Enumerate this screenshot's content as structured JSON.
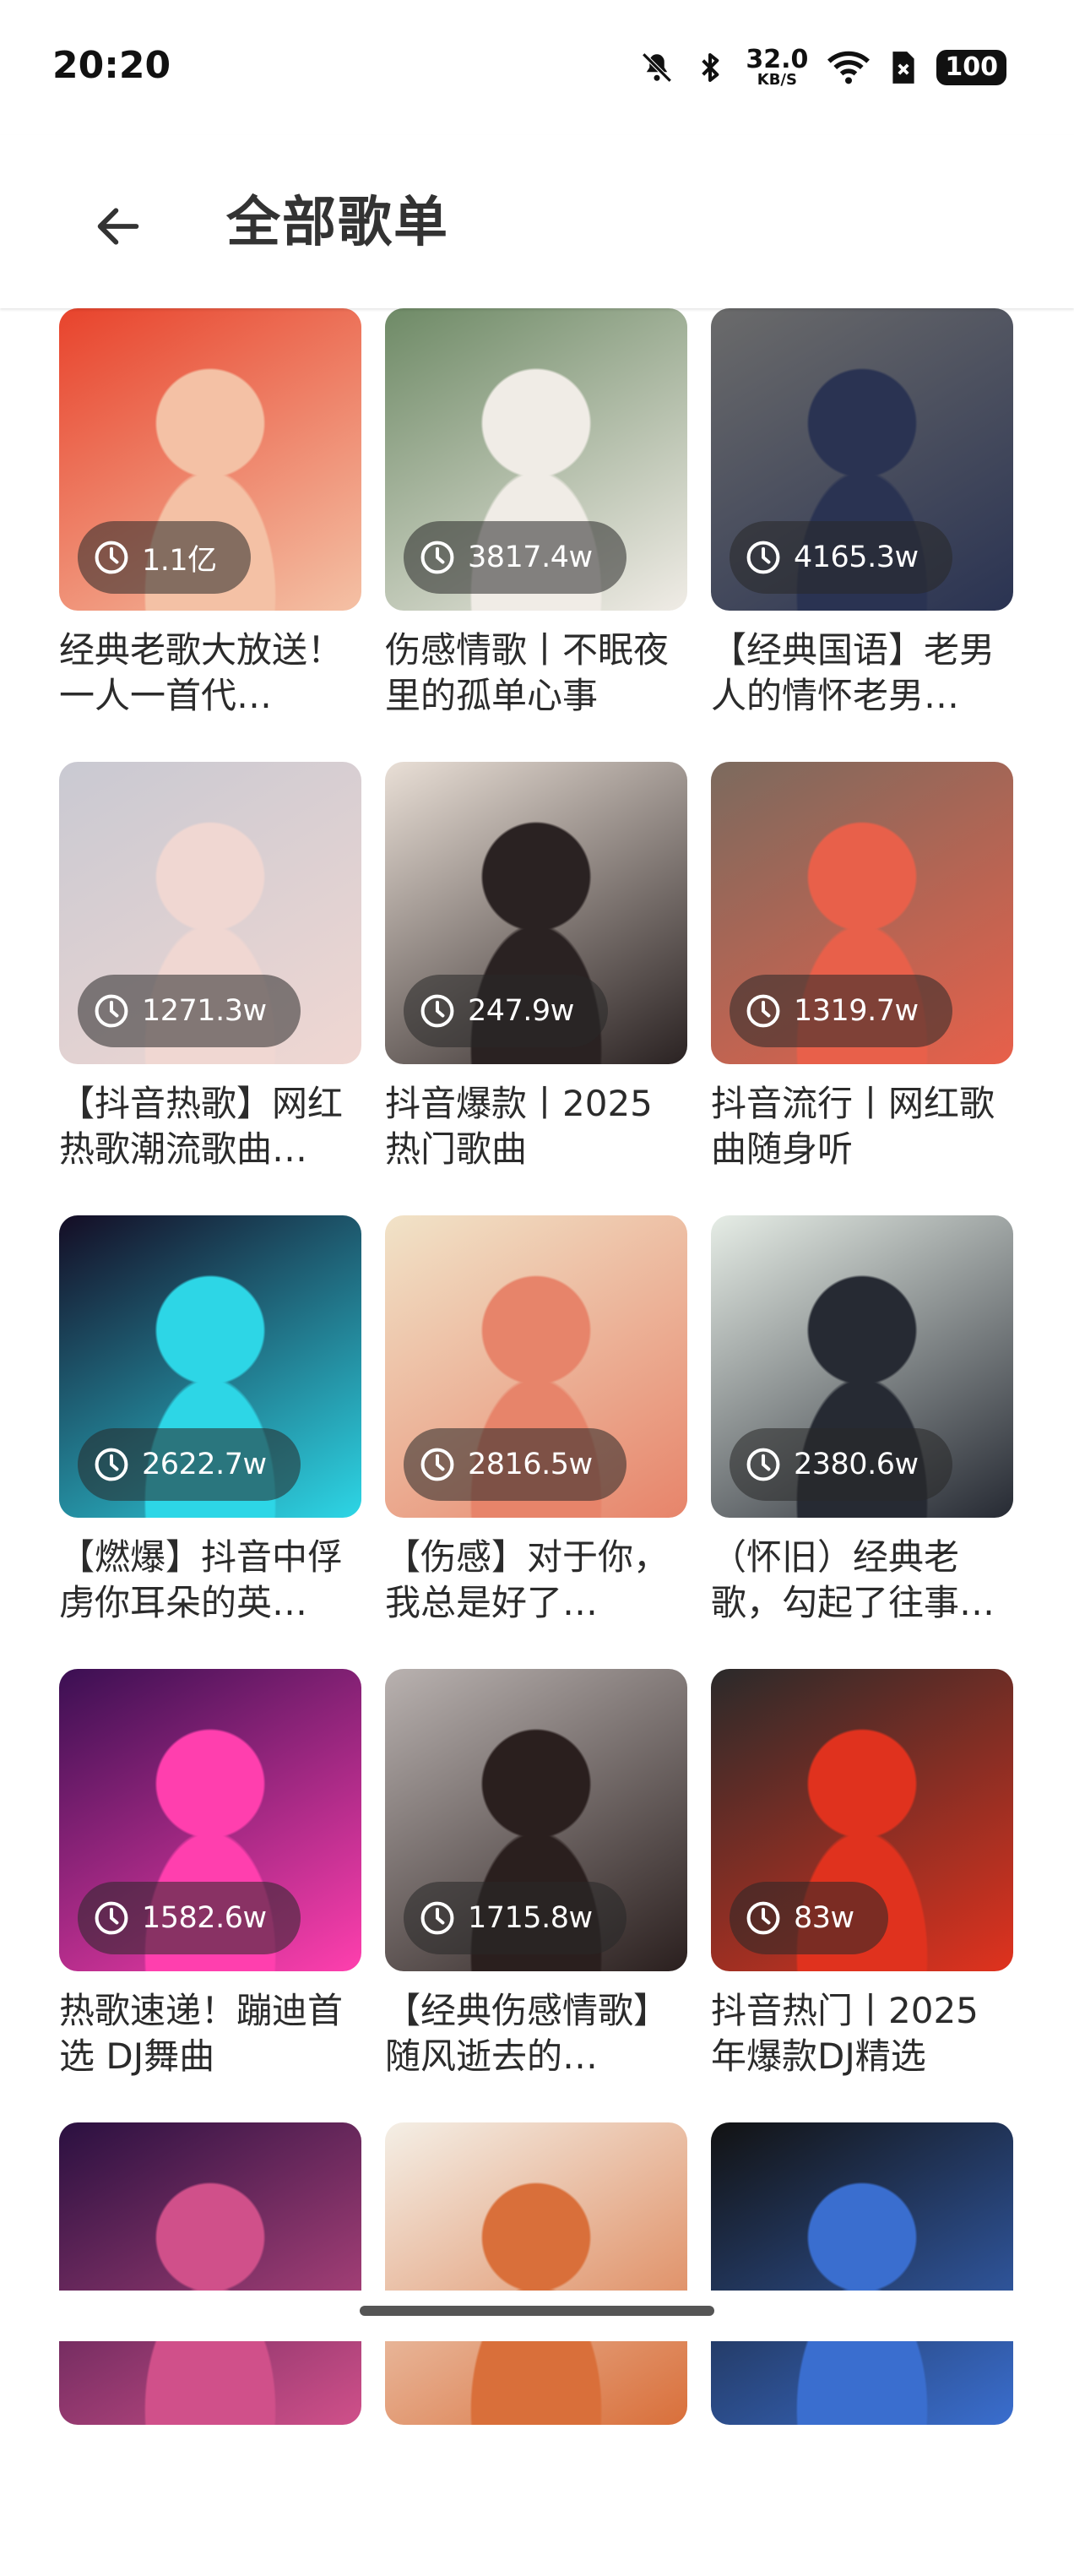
{
  "status_bar": {
    "time": "20:20",
    "net_speed_value": "32.0",
    "net_speed_unit": "KB/S",
    "battery": "100",
    "icons": [
      "bell-muted-icon",
      "bluetooth-icon",
      "wifi-icon",
      "sim-x-icon",
      "battery-icon"
    ]
  },
  "app_bar": {
    "back_icon": "arrow-left-icon",
    "title": "全部歌单"
  },
  "playlists": [
    {
      "plays": "1.1亿",
      "title": "经典老歌大放送！一人一首代…",
      "colors": [
        "#e8432c",
        "#f4c1a5"
      ]
    },
    {
      "plays": "3817.4w",
      "title": "伤感情歌丨不眠夜里的孤单心事",
      "colors": [
        "#6e8a66",
        "#f0ece6"
      ]
    },
    {
      "plays": "4165.3w",
      "title": "【经典国语】老男人的情怀老男…",
      "colors": [
        "#6b6b6b",
        "#2a3352"
      ]
    },
    {
      "plays": "1271.3w",
      "title": "【抖音热歌】网红热歌潮流歌曲…",
      "colors": [
        "#c9c9d2",
        "#f0d7d2"
      ]
    },
    {
      "plays": "247.9w",
      "title": "抖音爆款丨2025热门歌曲",
      "colors": [
        "#e9dfd6",
        "#2a2222"
      ]
    },
    {
      "plays": "1319.7w",
      "title": "抖音流行丨网红歌曲随身听",
      "colors": [
        "#7b6a5e",
        "#e8604a"
      ]
    },
    {
      "plays": "2622.7w",
      "title": "【燃爆】抖音中俘虏你耳朵的英…",
      "colors": [
        "#140c24",
        "#2dd6e6"
      ]
    },
    {
      "plays": "2816.5w",
      "title": "【伤感】对于你，我总是好了…",
      "colors": [
        "#f1e3c8",
        "#e7846a"
      ]
    },
    {
      "plays": "2380.6w",
      "title": "（怀旧）经典老歌，勾起了往事…",
      "colors": [
        "#e6ede6",
        "#262a33"
      ]
    },
    {
      "plays": "1582.6w",
      "title": "热歌速递！蹦迪首选 DJ舞曲",
      "colors": [
        "#3a0f52",
        "#ff3fae"
      ]
    },
    {
      "plays": "1715.8w",
      "title": "【经典伤感情歌】随风逝去的…",
      "colors": [
        "#b9b2b0",
        "#2a1f1e"
      ]
    },
    {
      "plays": "83w",
      "title": "抖音热门丨2025年爆款DJ精选",
      "colors": [
        "#2a2a2a",
        "#e0321e"
      ]
    },
    {
      "plays": "",
      "title": "",
      "colors": [
        "#2a1040",
        "#d0508a"
      ]
    },
    {
      "plays": "",
      "title": "",
      "colors": [
        "#f4efe6",
        "#d96f3a"
      ]
    },
    {
      "plays": "",
      "title": "",
      "colors": [
        "#121212",
        "#3a6ecf"
      ]
    }
  ]
}
